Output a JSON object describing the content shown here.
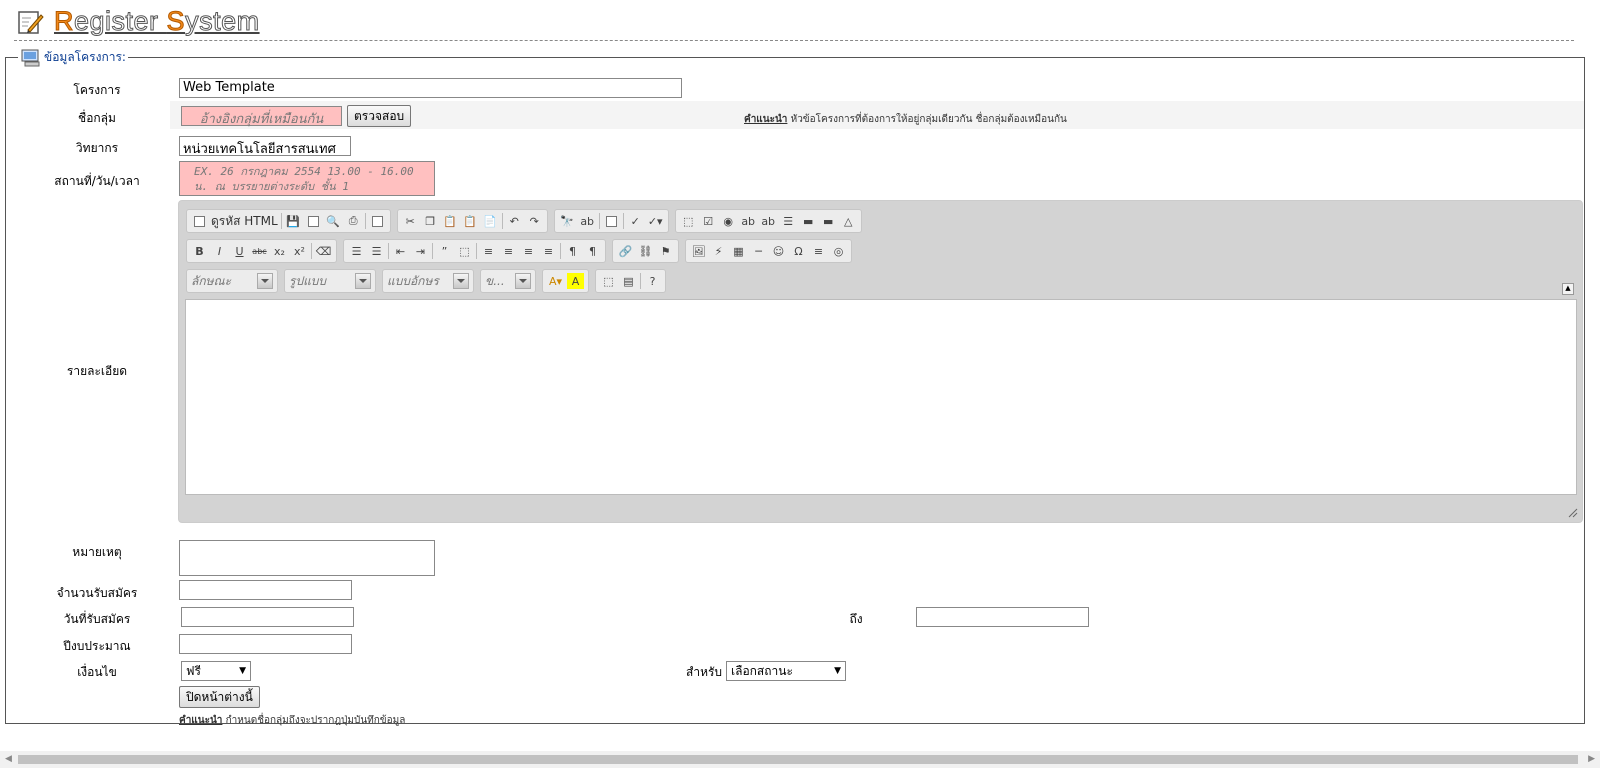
{
  "header": {
    "title_r": "R",
    "title_mid1": "egister ",
    "title_s": "S",
    "title_mid2": "ystem"
  },
  "fieldset": {
    "legend": "ข้อมูลโครงการ:"
  },
  "form": {
    "project": {
      "label": "โครงการ",
      "value": "Web Template"
    },
    "group": {
      "label": "ชื่อกลุ่ม",
      "placeholder": "อ้างอิงกลุ่มที่เหมือนกัน",
      "check_button": "ตรวจสอบ",
      "hint_title": "คำแนะนำ",
      "hint_text": " หัวข้อโครงการที่ต้องการให้อยู่กลุ่มเดียวกัน ชื่อกลุ่มต้องเหมือนกัน"
    },
    "speaker": {
      "label": "วิทยากร",
      "value": "หน่วยเทคโนโลยีสารสนเทศ"
    },
    "venue": {
      "label": "สถานที่/วัน/เวลา",
      "placeholder": "EX. 26 กรกฎาคม 2554 13.00 - 16.00 น. ณ บรรยายต่างระดับ ชั้น 1"
    },
    "detail": {
      "label": "รายละเอียด"
    },
    "note": {
      "label": "หมายเหตุ"
    },
    "capacity": {
      "label": "จำนวนรับสมัคร"
    },
    "reg_date": {
      "label": "วันที่รับสมัคร",
      "to_label": "ถึง"
    },
    "budget_year": {
      "label": "ปีงบประมาณ"
    },
    "condition": {
      "label": "เงื่อนไข",
      "value": "ฟรี",
      "for_label": "สำหรับ",
      "for_value": "เลือกสถานะ"
    },
    "close_button": "ปิดหน้าต่างนี้",
    "footer_hint_title": "คำแนะนำ",
    "footer_hint_text": " กำหนดชื่อกลุ่มถึงจะปรากฎปุ่มบันทึกข้อมูล"
  },
  "editor": {
    "source_label": "ดูรหัส HTML",
    "combos": [
      "ลักษณะ",
      "รูปแบบ",
      "แบบอักษร",
      "ข..."
    ]
  }
}
